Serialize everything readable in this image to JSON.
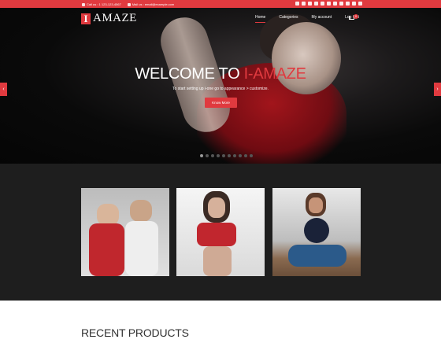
{
  "topbar": {
    "phone": "Call us : 1 123-123-4567",
    "email": "Mail us : email@example.com",
    "social_icons": [
      "facebook-icon",
      "twitter-icon",
      "google-plus-icon",
      "linkedin-icon",
      "youtube-icon",
      "pinterest-icon",
      "instagram-icon",
      "vimeo-icon",
      "flickr-icon",
      "tumblr-icon",
      "rss-icon"
    ]
  },
  "logo": {
    "mark": "I",
    "text": "AMAZE"
  },
  "nav": {
    "items": [
      "Home",
      "Categories",
      "My account",
      "Log Out"
    ],
    "active": "Home",
    "cart_count": "0"
  },
  "hero": {
    "title_prefix": "WELCOME TO ",
    "title_brand": "I-AMAZE",
    "subtitle": "To start setting up i-one go to appearance > customize.",
    "cta_label": "Know More",
    "prev_arrow": "‹",
    "next_arrow": "›"
  },
  "colors": {
    "accent": "#e03a3f",
    "dark": "#1e1e1e"
  },
  "products": {
    "title": "RECENT PRODUCTS"
  }
}
